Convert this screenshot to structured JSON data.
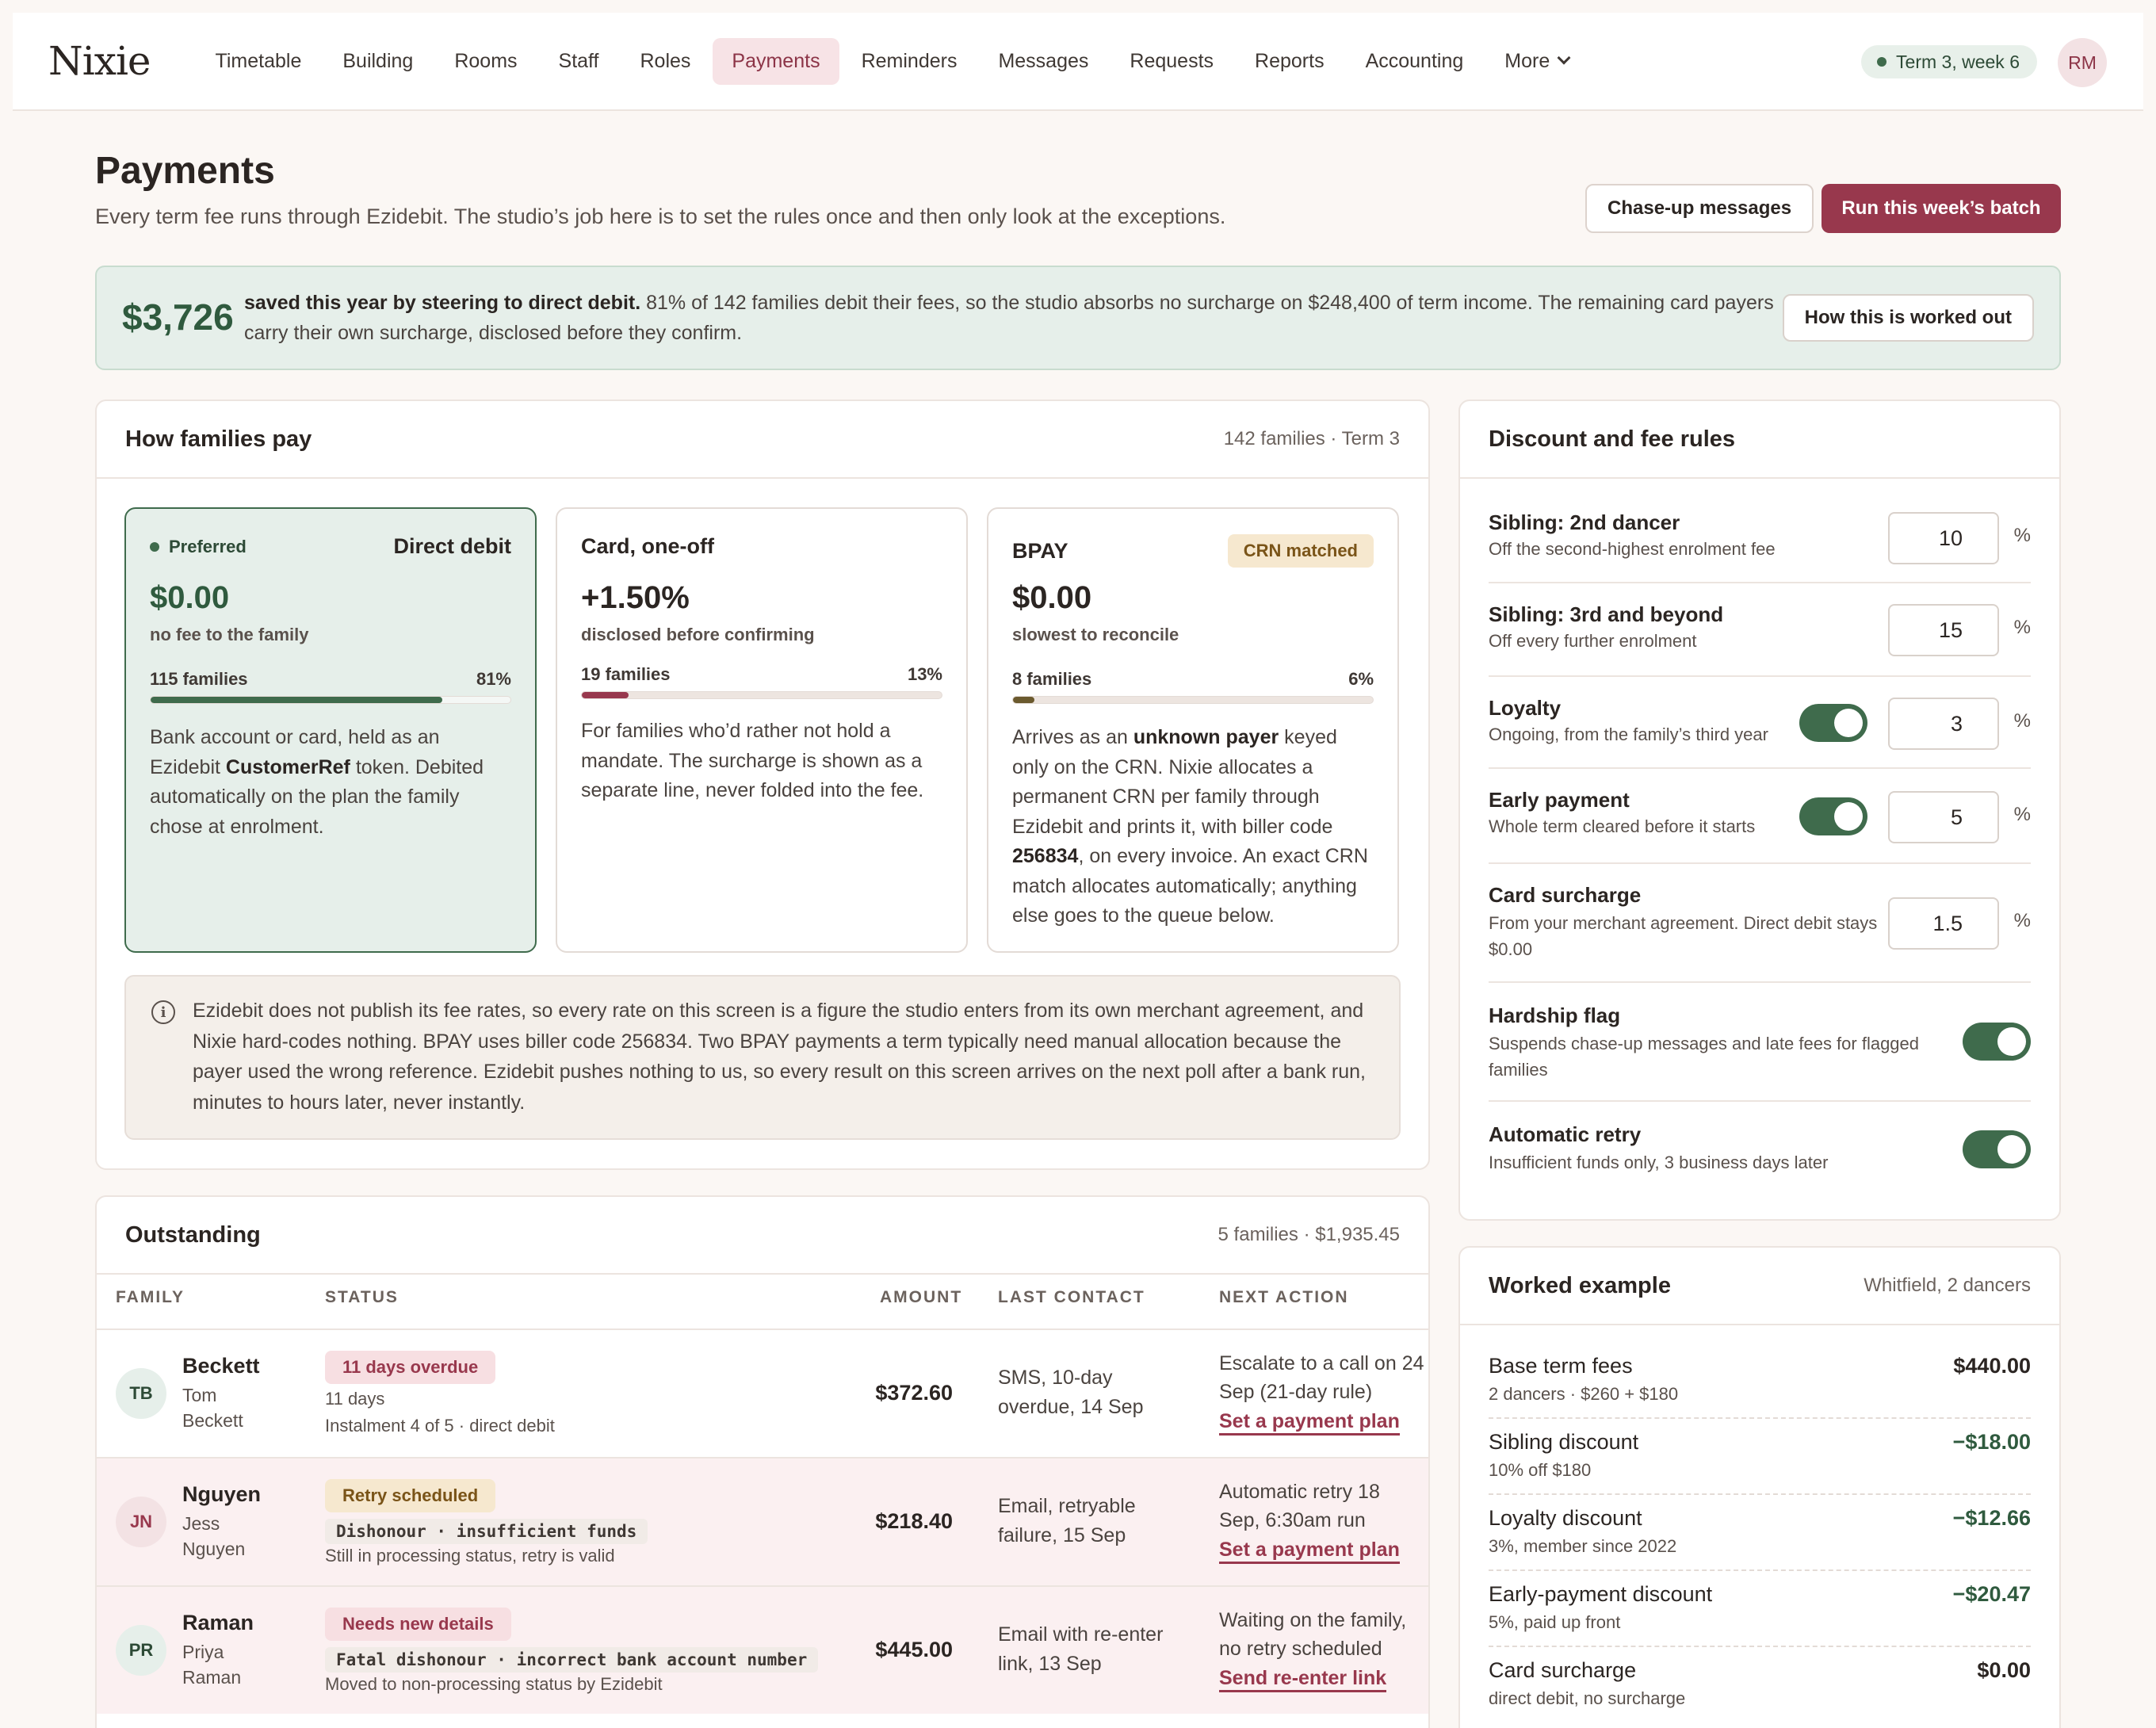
{
  "app": {
    "logo": "Nixie",
    "nav": [
      "Timetable",
      "Building",
      "Rooms",
      "Staff",
      "Roles",
      "Payments",
      "Reminders",
      "Messages",
      "Requests",
      "Reports",
      "Accounting",
      "More"
    ],
    "term": "Term 3, week 6",
    "user_initials": "RM"
  },
  "header": {
    "title": "Payments",
    "subtitle": "Every term fee runs through Ezidebit. The studio’s job here is to set the rules once and then only look at the exceptions.",
    "chase_button": "Chase-up messages",
    "batch_button": "Run this week’s batch"
  },
  "banner": {
    "amount": "$3,726",
    "lead": "saved this year by steering to direct debit.",
    "text": " 81% of 142 families debit their fees, so the studio absorbs no surcharge on $248,400 of term income. The remaining card payers carry their own surcharge, disclosed before they confirm.",
    "button": "How this is worked out"
  },
  "how_pay": {
    "title": "How families pay",
    "meta": "142 families · Term 3",
    "methods": [
      {
        "tag": "Preferred",
        "name": "Direct debit",
        "fee": "$0.00",
        "fee_sub": "no fee to the family",
        "families": "115 families",
        "percent": "81%",
        "share": 0.81,
        "desc_1": "Bank account or card, held as an Ezidebit ",
        "desc_bold": "CustomerRef",
        "desc_2": " token. Debited automatically on the plan the family chose at enrolment."
      },
      {
        "name": "Card, one-off",
        "fee": "+1.50%",
        "fee_sub": "disclosed before confirming",
        "families": "19 families",
        "percent": "13%",
        "share": 0.13,
        "desc": "For families who’d rather not hold a mandate. The surcharge is shown as a separate line, never folded into the fee."
      },
      {
        "name": "BPAY",
        "badge": "CRN matched",
        "fee": "$0.00",
        "fee_sub": "slowest to reconcile",
        "families": "8 families",
        "percent": "6%",
        "share": 0.06,
        "desc_1": "Arrives as an ",
        "desc_bold1": "unknown payer",
        "desc_2": " keyed only on the CRN. Nixie allocates a permanent CRN per family through Ezidebit and prints it, with biller code ",
        "desc_bold2": "256834",
        "desc_3": ", on every invoice. An exact CRN match allocates automatically; anything else goes to the queue below."
      }
    ],
    "info": "Ezidebit does not publish its fee rates, so every rate on this screen is a figure the studio enters from its own merchant agreement, and Nixie hard-codes nothing. BPAY uses biller code 256834. Two BPAY payments a term typically need manual allocation because the payer used the wrong reference. Ezidebit pushes nothing to us, so every result on this screen arrives on the next poll after a bank run, minutes to hours later, never instantly."
  },
  "outstanding": {
    "title": "Outstanding",
    "meta": "5 families · $1,935.45",
    "columns": [
      "FAMILY",
      "STATUS",
      "AMOUNT",
      "LAST CONTACT",
      "NEXT ACTION"
    ],
    "rows": [
      {
        "initials": "TB",
        "family": "Beckett",
        "person": "Tom Beckett",
        "badge": "11 days overdue",
        "line1": "11 days",
        "line2": "Instalment 4 of 5 · direct debit",
        "amount": "$372.60",
        "last_contact": "SMS, 10-day overdue, 14 Sep",
        "next_action": "Escalate to a call on 24 Sep (21-day rule)",
        "link": "Set a payment plan"
      },
      {
        "initials": "JN",
        "family": "Nguyen",
        "person": "Jess Nguyen",
        "badge": "Retry scheduled",
        "code": "Dishonour · insufficient funds",
        "line2": "Still in processing status, retry is valid",
        "amount": "$218.40",
        "last_contact": "Email, retryable failure, 15 Sep",
        "next_action": "Automatic retry 18 Sep, 6:30am run",
        "link": "Set a payment plan"
      },
      {
        "initials": "PR",
        "family": "Raman",
        "person": "Priya Raman",
        "badge": "Needs new details",
        "code": "Fatal dishonour · incorrect bank account number",
        "line2": "Moved to non-processing status by Ezidebit",
        "amount": "$445.00",
        "last_contact": "Email with re-enter link, 13 Sep",
        "next_action": "Waiting on the family, no retry scheduled",
        "link": "Send re-enter link"
      }
    ]
  },
  "rules": {
    "title": "Discount and fee rules",
    "items": [
      {
        "name": "Sibling: 2nd dancer",
        "desc": "Off the second-highest enrolment fee",
        "value": "10",
        "unit": "%"
      },
      {
        "name": "Sibling: 3rd and beyond",
        "desc": "Off every further enrolment",
        "value": "15",
        "unit": "%"
      },
      {
        "name": "Loyalty",
        "desc": "Ongoing, from the family’s third year",
        "value": "3",
        "unit": "%",
        "toggle": true
      },
      {
        "name": "Early payment",
        "desc": "Whole term cleared before it starts",
        "value": "5",
        "unit": "%",
        "toggle": true
      },
      {
        "name": "Card surcharge",
        "desc": "From your merchant agreement. Direct debit stays $0.00",
        "value": "1.5",
        "unit": "%"
      },
      {
        "name": "Hardship flag",
        "desc": "Suspends chase-up messages and late fees for flagged families",
        "toggle": true
      },
      {
        "name": "Automatic retry",
        "desc": "Insufficient funds only, 3 business days later",
        "toggle": true
      }
    ]
  },
  "worked": {
    "title": "Worked example",
    "meta": "Whitfield, 2 dancers",
    "rows": [
      {
        "label": "Base term fees",
        "sub": "2 dancers · $260 + $180",
        "value": "$440.00"
      },
      {
        "label": "Sibling discount",
        "sub": "10% off $180",
        "value": "−$18.00"
      },
      {
        "label": "Loyalty discount",
        "sub": "3%, member since 2022",
        "value": "−$12.66"
      },
      {
        "label": "Early-payment discount",
        "sub": "5%, paid up front",
        "value": "−$20.47"
      },
      {
        "label": "Card surcharge",
        "sub": "direct debit, no surcharge",
        "value": "$0.00"
      }
    ]
  },
  "colors": {
    "accent": "#98384d",
    "green": "#3f6b4c",
    "overdue_badge": "#f7dfe2",
    "retry_badge": "#f6e8cf"
  }
}
